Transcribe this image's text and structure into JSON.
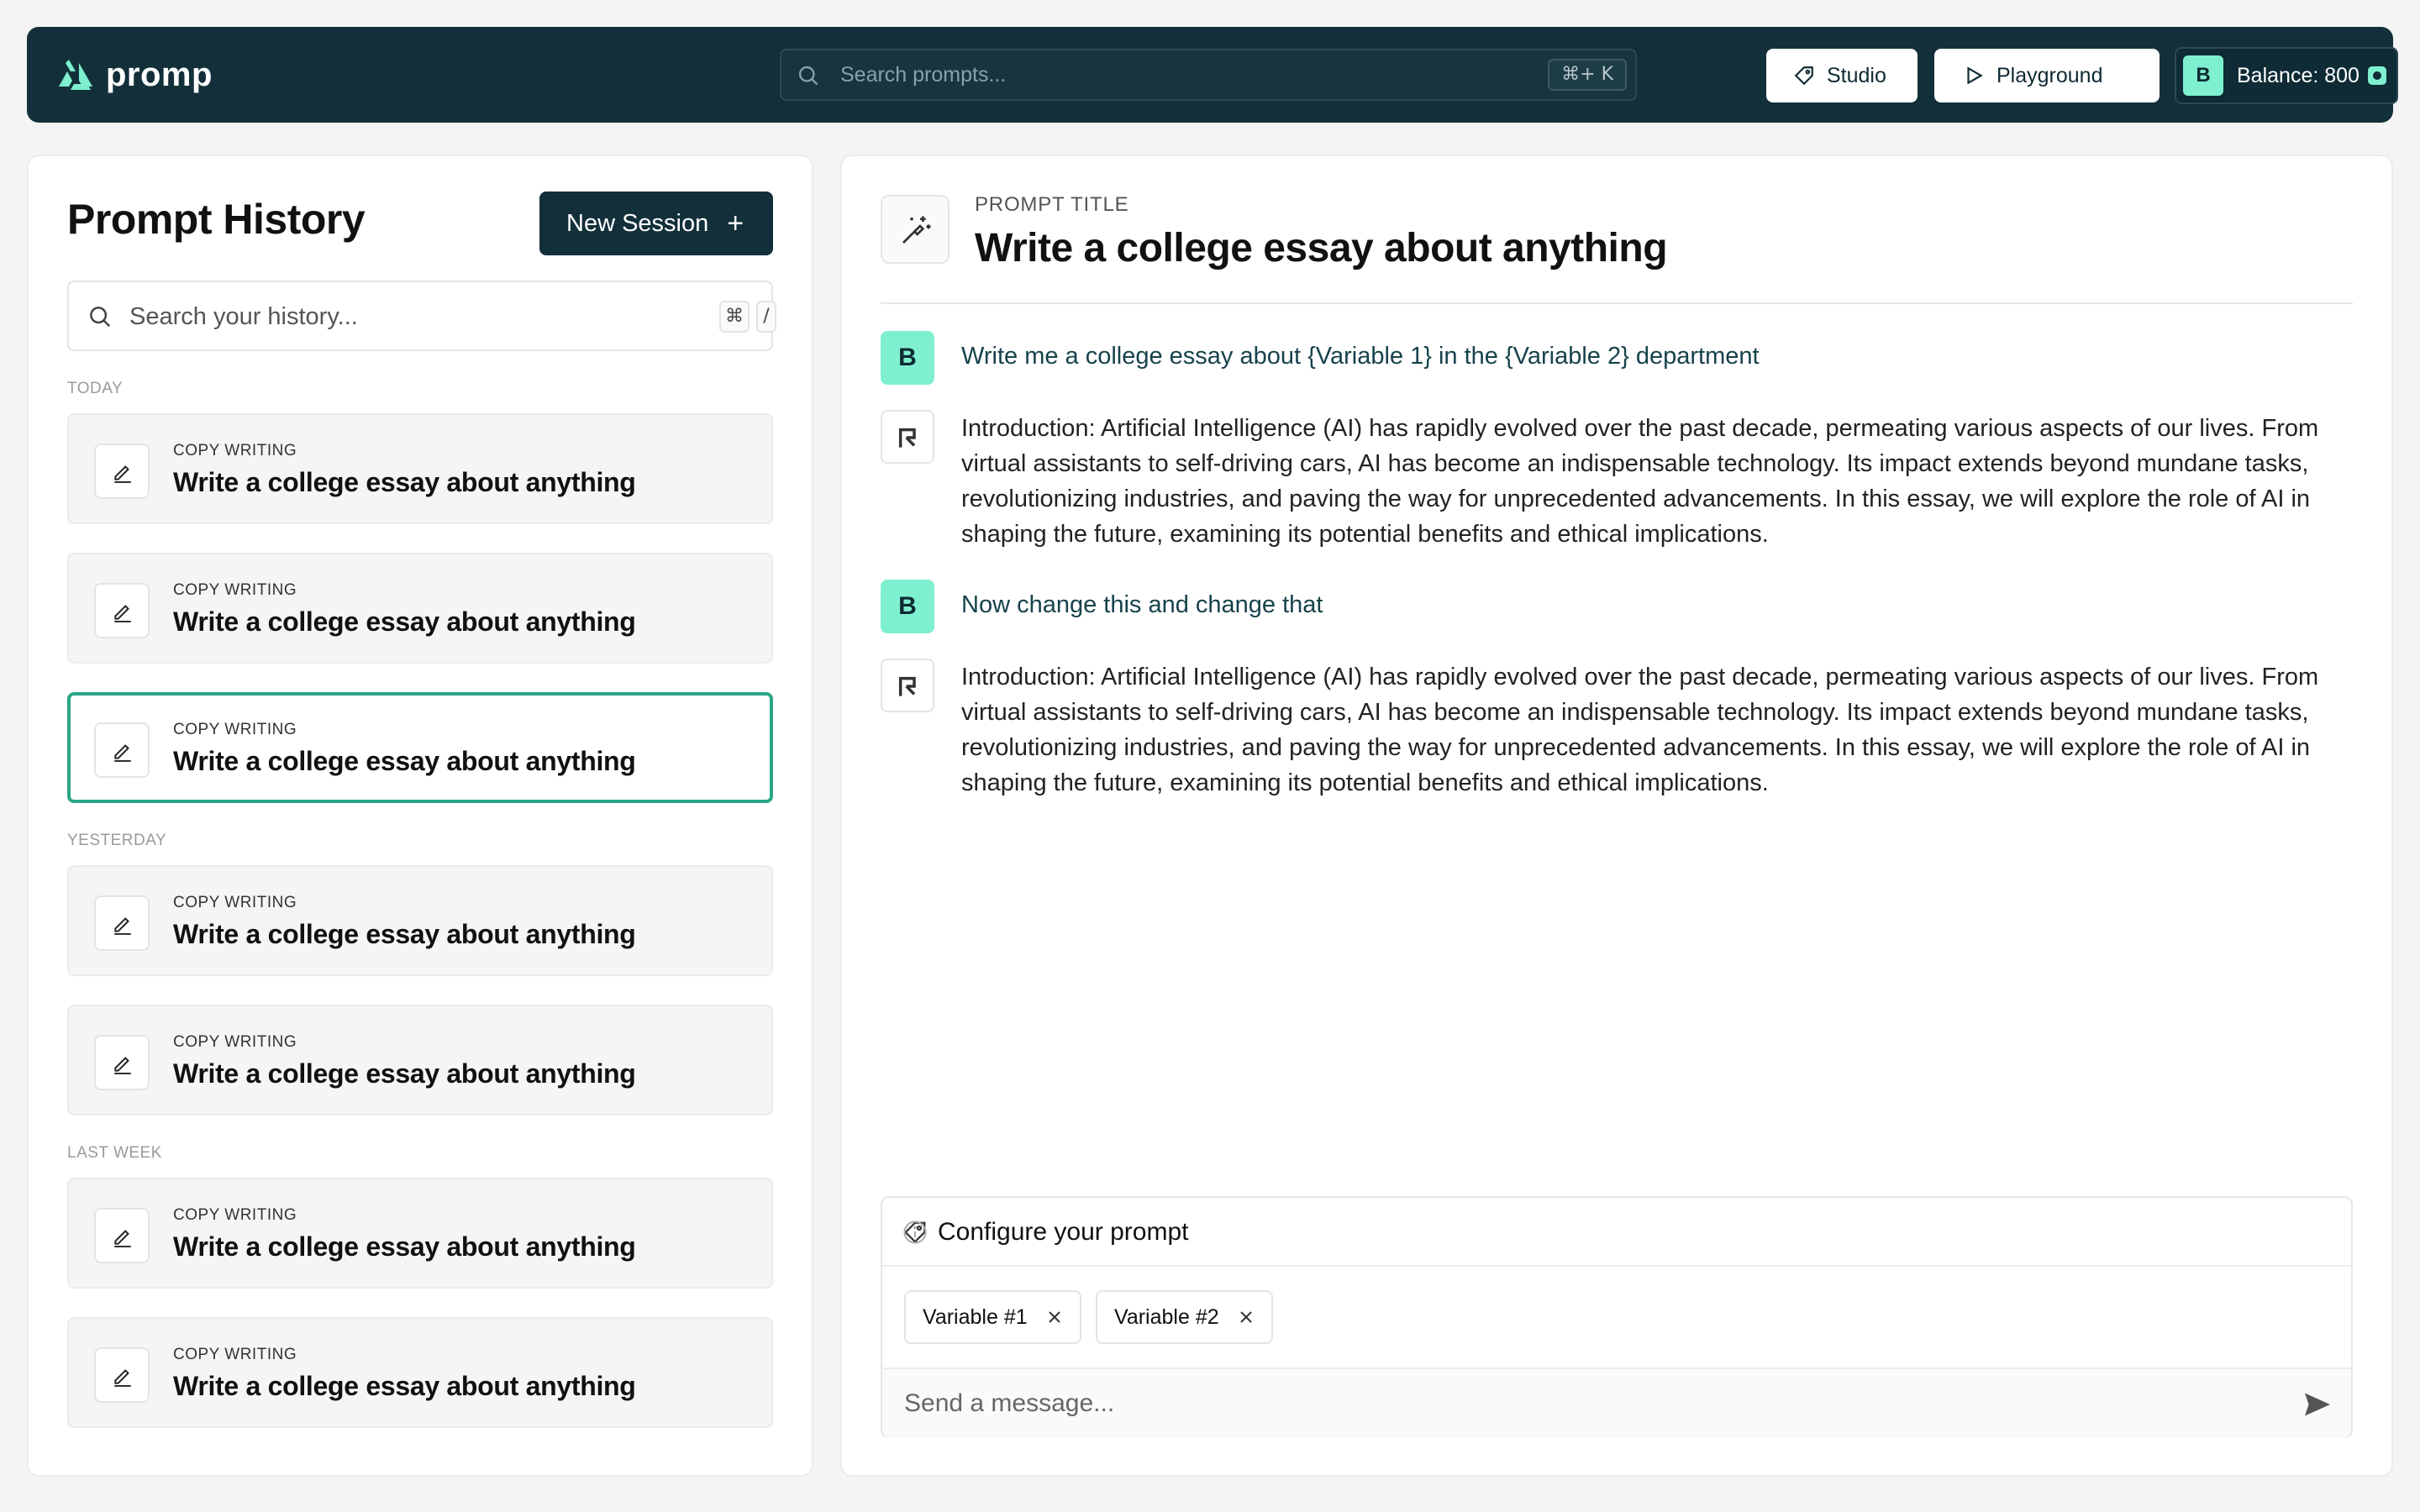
{
  "app": {
    "name": "promp"
  },
  "header": {
    "search_placeholder": "Search prompts...",
    "search_shortcut": "⌘+ K",
    "studio_label": "Studio",
    "playground_label": "Playground",
    "avatar_initial": "B",
    "balance_label": "Balance: 800"
  },
  "history": {
    "title": "Prompt History",
    "new_session_label": "New Session",
    "new_session_plus": "+",
    "search_placeholder": "Search your history...",
    "shortcut_keys": [
      "⌘",
      "/"
    ],
    "sections": [
      {
        "label": "TODAY",
        "items": [
          {
            "category": "COPY WRITING",
            "title": "Write a college essay about anything"
          },
          {
            "category": "COPY WRITING",
            "title": "Write a college essay about anything"
          },
          {
            "category": "COPY WRITING",
            "title": "Write a college essay about anything",
            "active": true
          }
        ]
      },
      {
        "label": "YESTERDAY",
        "items": [
          {
            "category": "COPY WRITING",
            "title": "Write a college essay about anything"
          },
          {
            "category": "COPY WRITING",
            "title": "Write a college essay about anything"
          }
        ]
      },
      {
        "label": "LAST WEEK",
        "items": [
          {
            "category": "COPY WRITING",
            "title": "Write a college essay about anything"
          },
          {
            "category": "COPY WRITING",
            "title": "Write a college essay about anything"
          }
        ]
      }
    ]
  },
  "prompt": {
    "label": "PROMPT TITLE",
    "title": "Write a college essay about anything",
    "messages": [
      {
        "role": "user",
        "avatar": "B",
        "text": "Write me a college essay about {Variable 1} in the {Variable 2} department"
      },
      {
        "role": "assistant",
        "text": "Introduction: Artificial Intelligence (AI) has rapidly evolved over the past decade, permeating various aspects of our lives. From virtual assistants to self-driving cars, AI has become an indispensable technology. Its impact extends beyond mundane tasks, revolutionizing industries, and paving the way for unprecedented advancements. In this essay, we will explore the role of AI in shaping the future, examining its potential benefits and ethical implications."
      },
      {
        "role": "user",
        "avatar": "B",
        "text": "Now change this and change that"
      },
      {
        "role": "assistant",
        "text": "Introduction: Artificial Intelligence (AI) has rapidly evolved over the past decade, permeating various aspects of our lives. From virtual assistants to self-driving cars, AI has become an indispensable technology. Its impact extends beyond mundane tasks, revolutionizing industries, and paving the way for unprecedented advancements. In this essay, we will explore the role of AI in shaping the future, examining its potential benefits and ethical implications."
      }
    ]
  },
  "config": {
    "title": "Configure your prompt",
    "variables": [
      "Variable #1",
      "Variable #2"
    ],
    "message_placeholder": "Send a message..."
  },
  "colors": {
    "brand_dark": "#13303a",
    "accent": "#7ef0cf",
    "active_border": "#2aa684"
  },
  "icons": [
    "logo-icon",
    "search-icon",
    "tag-icon",
    "play-icon",
    "coin-icon",
    "pencil-icon",
    "magic-wand-icon",
    "bot-logo-icon",
    "info-icon",
    "close-icon",
    "send-icon"
  ]
}
